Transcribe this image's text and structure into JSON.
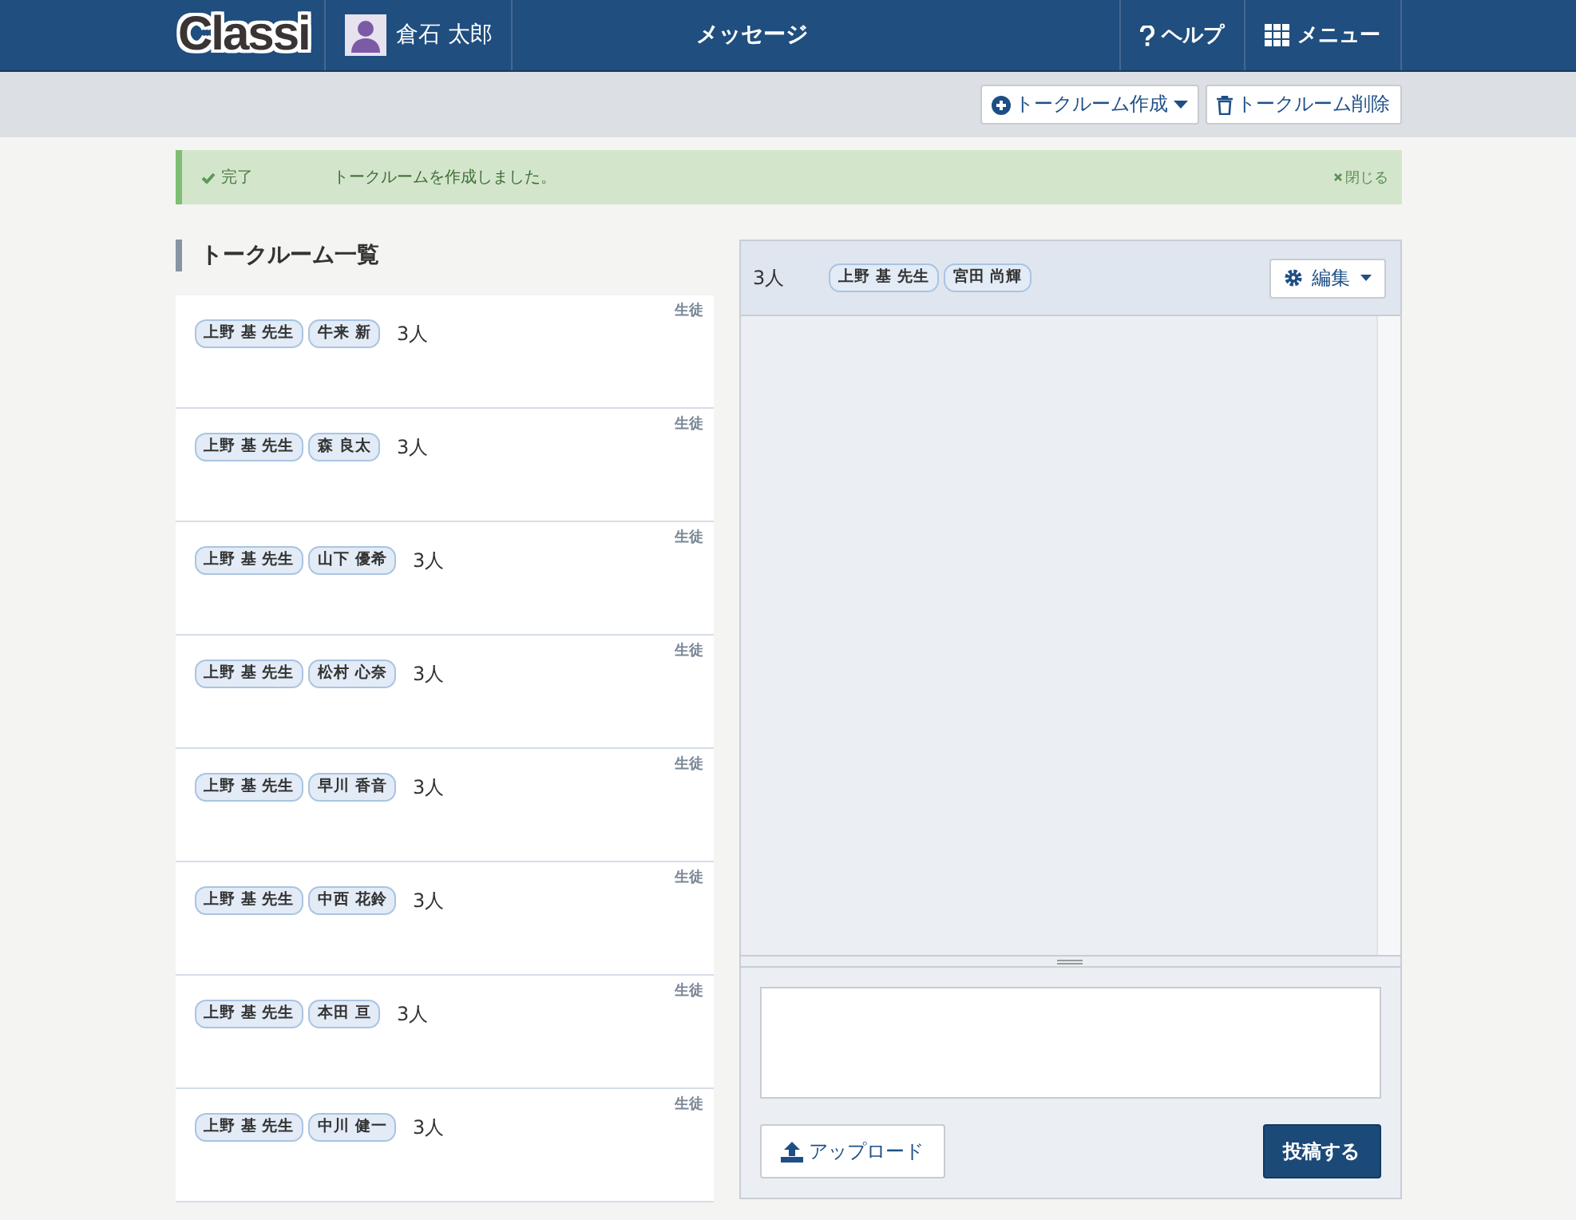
{
  "header": {
    "logo": "Classi",
    "user": "倉石 太郎",
    "title": "メッセージ",
    "help": "ヘルプ",
    "menu": "メニュー"
  },
  "toolbar": {
    "create": "トークルーム作成",
    "delete": "トークルーム削除"
  },
  "alert": {
    "status": "完了",
    "message": "トークルームを作成しました。",
    "close": "閉じる"
  },
  "room_list": {
    "title": "トークルーム一覧",
    "rooms": [
      {
        "members": [
          "上野 基 先生",
          "牛来 新"
        ],
        "count": "3人",
        "type": "生徒"
      },
      {
        "members": [
          "上野 基 先生",
          "森 良太"
        ],
        "count": "3人",
        "type": "生徒"
      },
      {
        "members": [
          "上野 基 先生",
          "山下 優希"
        ],
        "count": "3人",
        "type": "生徒"
      },
      {
        "members": [
          "上野 基 先生",
          "松村 心奈"
        ],
        "count": "3人",
        "type": "生徒"
      },
      {
        "members": [
          "上野 基 先生",
          "早川 香音"
        ],
        "count": "3人",
        "type": "生徒"
      },
      {
        "members": [
          "上野 基 先生",
          "中西 花鈴"
        ],
        "count": "3人",
        "type": "生徒"
      },
      {
        "members": [
          "上野 基 先生",
          "本田 亘"
        ],
        "count": "3人",
        "type": "生徒"
      },
      {
        "members": [
          "上野 基 先生",
          "中川 健一"
        ],
        "count": "3人",
        "type": "生徒"
      }
    ]
  },
  "chat": {
    "count": "3人",
    "members": [
      "上野 基 先生",
      "宮田 尚輝"
    ],
    "edit": "編集",
    "upload": "アップロード",
    "post": "投稿する"
  }
}
